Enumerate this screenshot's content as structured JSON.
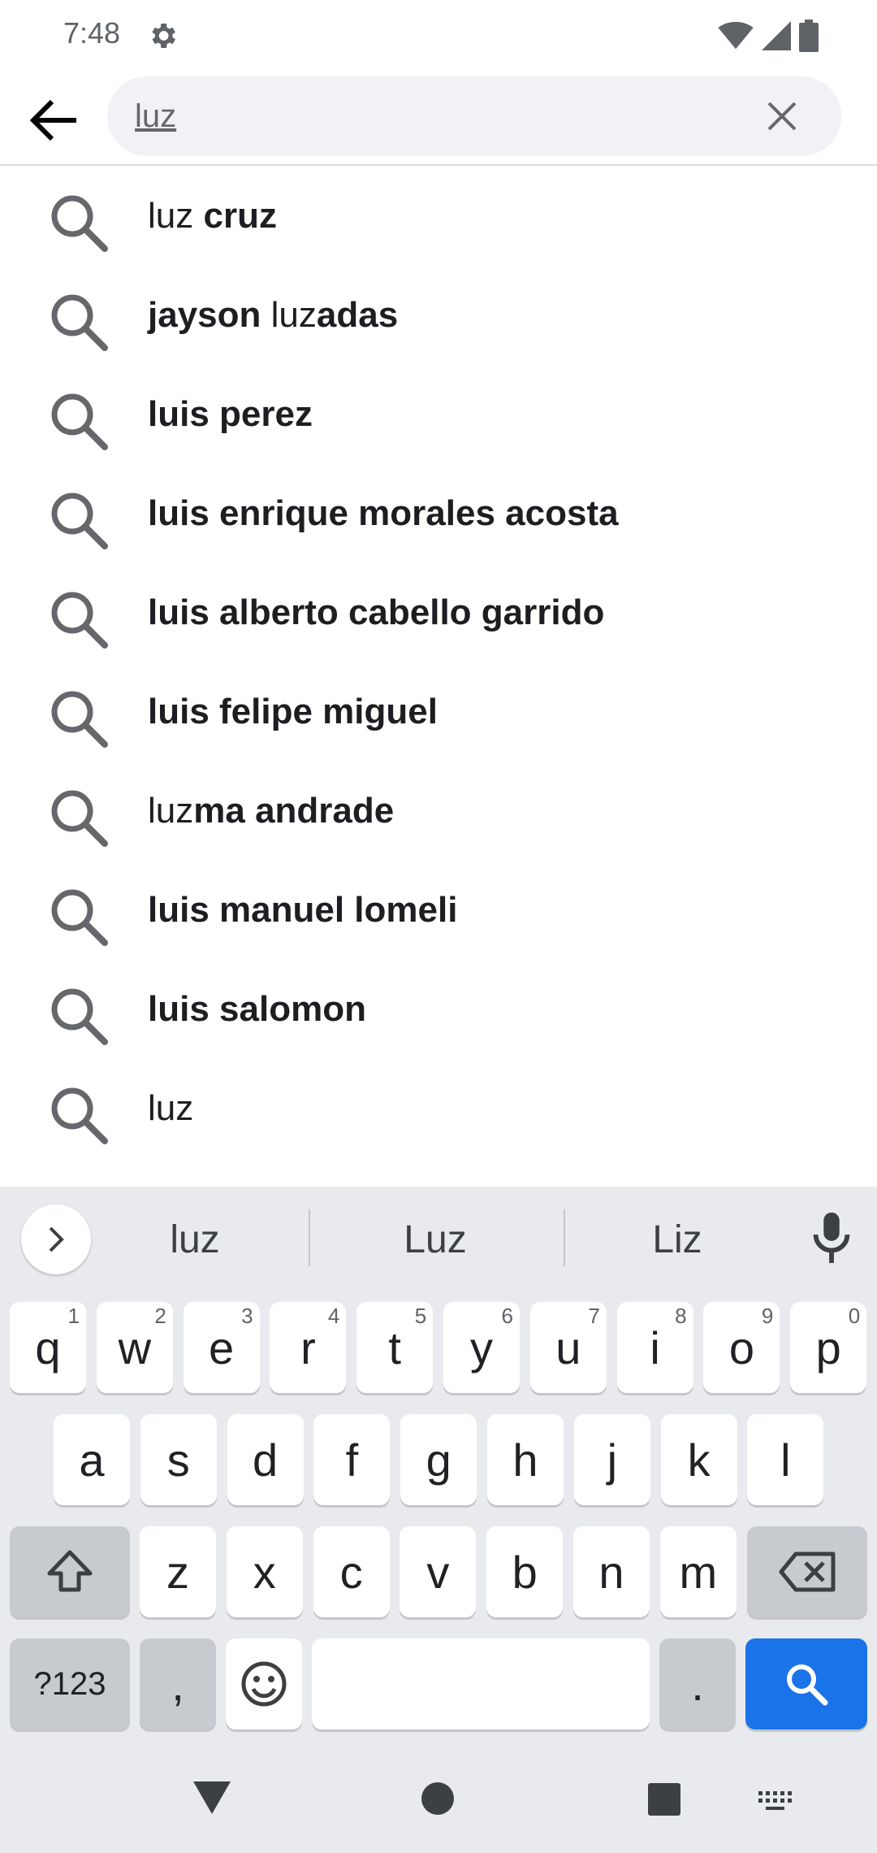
{
  "status_bar": {
    "time": "7:48"
  },
  "search": {
    "value": "luz"
  },
  "suggestions": [
    {
      "normal1": "luz ",
      "bold1": "cruz",
      "normal2": "",
      "bold2": ""
    },
    {
      "normal1": "",
      "bold1": "jayson ",
      "normal2": "luz",
      "bold2": "adas"
    },
    {
      "normal1": "",
      "bold1": "luis perez",
      "normal2": "",
      "bold2": ""
    },
    {
      "normal1": "",
      "bold1": "luis enrique morales acosta",
      "normal2": "",
      "bold2": ""
    },
    {
      "normal1": "",
      "bold1": "luis alberto cabello garrido",
      "normal2": "",
      "bold2": ""
    },
    {
      "normal1": "",
      "bold1": "luis felipe miguel",
      "normal2": "",
      "bold2": ""
    },
    {
      "normal1": "luz",
      "bold1": "ma andrade",
      "normal2": "",
      "bold2": ""
    },
    {
      "normal1": "",
      "bold1": "luis manuel lomeli",
      "normal2": "",
      "bold2": ""
    },
    {
      "normal1": "",
      "bold1": "luis salomon",
      "normal2": "",
      "bold2": ""
    },
    {
      "normal1": "luz",
      "bold1": "",
      "normal2": "",
      "bold2": ""
    }
  ],
  "keyboard": {
    "suggestions": [
      "luz",
      "Luz",
      "Liz"
    ],
    "row1": [
      {
        "k": "q",
        "h": "1"
      },
      {
        "k": "w",
        "h": "2"
      },
      {
        "k": "e",
        "h": "3"
      },
      {
        "k": "r",
        "h": "4"
      },
      {
        "k": "t",
        "h": "5"
      },
      {
        "k": "y",
        "h": "6"
      },
      {
        "k": "u",
        "h": "7"
      },
      {
        "k": "i",
        "h": "8"
      },
      {
        "k": "o",
        "h": "9"
      },
      {
        "k": "p",
        "h": "0"
      }
    ],
    "row2": [
      "a",
      "s",
      "d",
      "f",
      "g",
      "h",
      "j",
      "k",
      "l"
    ],
    "row3": [
      "z",
      "x",
      "c",
      "v",
      "b",
      "n",
      "m"
    ],
    "symbols_label": "?123",
    "comma_label": ",",
    "period_label": "."
  },
  "colors": {
    "accent": "#1a73e8",
    "keyboard_bg": "#e8eaed",
    "search_bg": "#f0f2f5"
  }
}
